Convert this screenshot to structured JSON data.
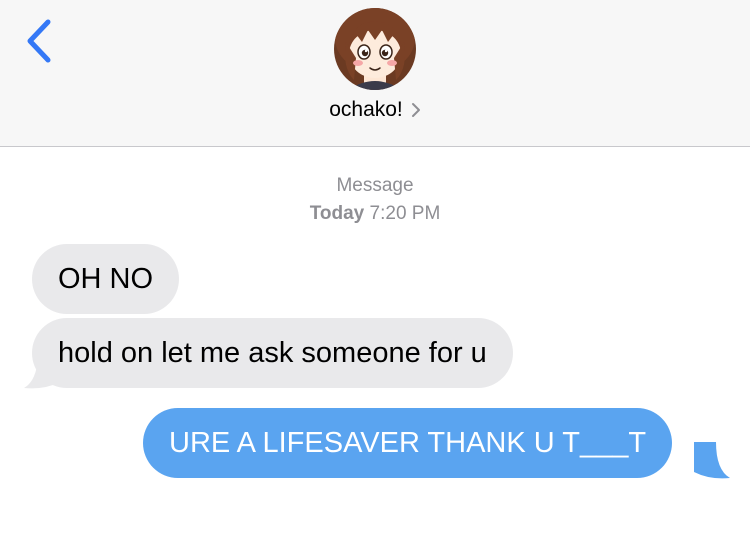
{
  "header": {
    "back_icon": "chevron-left-icon",
    "contact_name": "ochako!",
    "contact_chevron": "›",
    "accent_color": "#3478f6"
  },
  "conversation": {
    "service_label": "Message",
    "day_label": "Today",
    "time_label": "7:20 PM"
  },
  "messages": [
    {
      "direction": "received",
      "text": "OH NO"
    },
    {
      "direction": "received",
      "text": "hold on let me ask someone for u"
    },
    {
      "direction": "sent",
      "text": "URE A LIFESAVER THANK U T___T"
    }
  ],
  "colors": {
    "received_bubble": "#e9e9eb",
    "sent_bubble": "#5aa4f0",
    "header_bg": "#f7f7f7",
    "meta_text": "#8e8e93"
  }
}
